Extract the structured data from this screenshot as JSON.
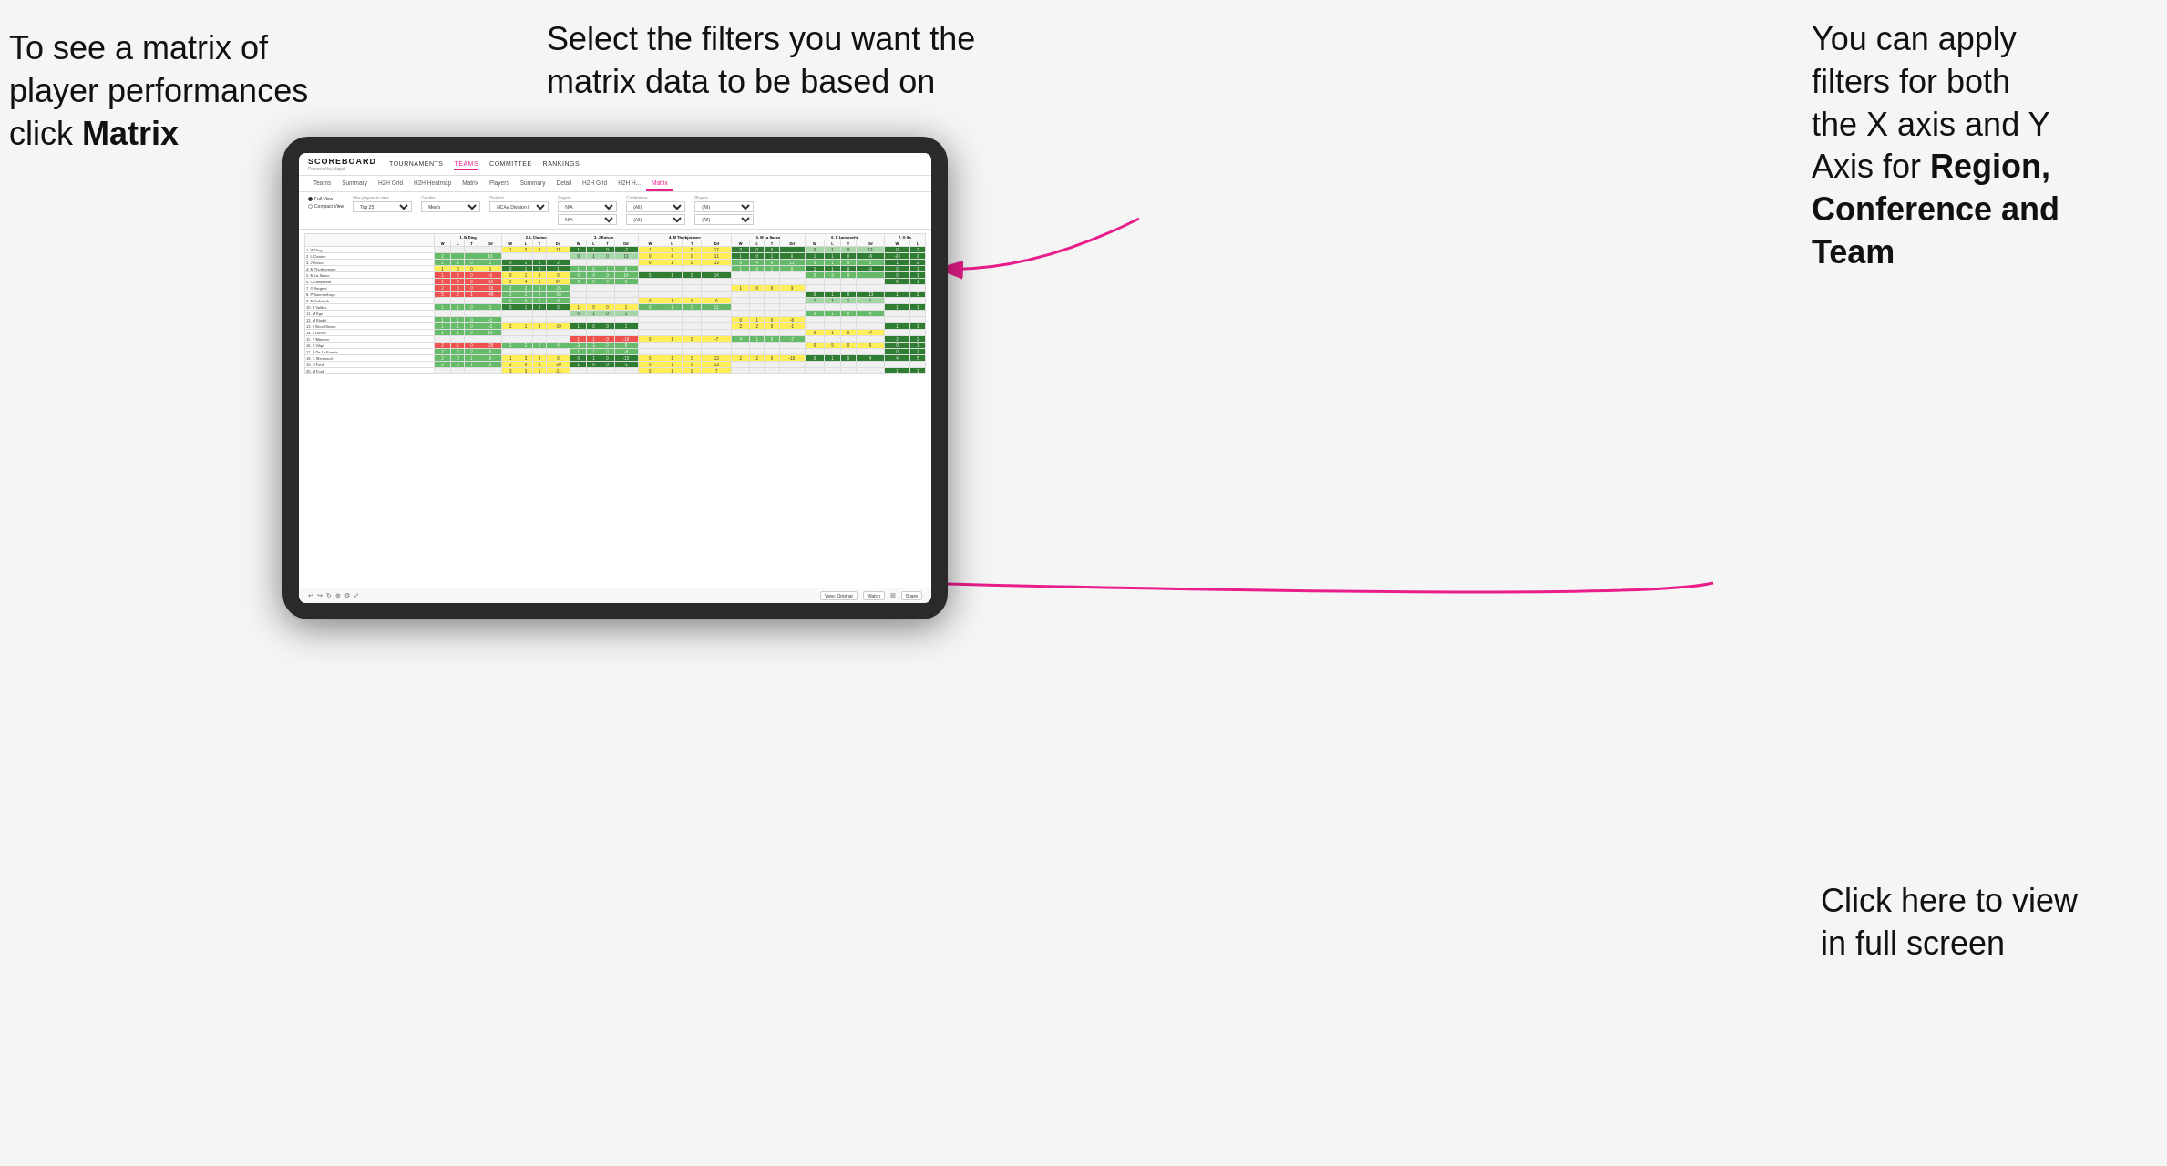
{
  "annotations": {
    "top_left": {
      "line1": "To see a matrix of",
      "line2": "player performances",
      "line3_prefix": "click ",
      "line3_bold": "Matrix"
    },
    "top_center": {
      "text": "Select the filters you want the matrix data to be based on"
    },
    "top_right": {
      "line1": "You  can apply",
      "line2": "filters for both",
      "line3": "the X axis and Y",
      "line4_prefix": "Axis for ",
      "line4_bold": "Region,",
      "line5_bold": "Conference and",
      "line6_bold": "Team"
    },
    "bottom_right": {
      "line1": "Click here to view",
      "line2": "in full screen"
    }
  },
  "app": {
    "logo_title": "SCOREBOARD",
    "logo_sub": "Powered by clippd",
    "nav_items": [
      "TOURNAMENTS",
      "TEAMS",
      "COMMITTEE",
      "RANKINGS"
    ],
    "sub_nav_items": [
      "Teams",
      "Summary",
      "H2H Grid",
      "H2H Heatmap",
      "Matrix",
      "Players",
      "Summary",
      "Detail",
      "H2H Grid",
      "H2H H...",
      "Matrix"
    ],
    "active_nav": "TEAMS",
    "active_sub": "Matrix",
    "filters": {
      "view_full": "Full View",
      "view_compact": "Compact View",
      "max_players_label": "Max players in view",
      "max_players_val": "Top 25",
      "gender_label": "Gender",
      "gender_val": "Men's",
      "division_label": "Division",
      "division_val": "NCAA Division I",
      "region_label": "Region",
      "region_val1": "N/A",
      "region_val2": "N/A",
      "conference_label": "Conference",
      "conf_val1": "(All)",
      "conf_val2": "(All)",
      "players_label": "Players",
      "players_val1": "(All)",
      "players_val2": "(All)"
    },
    "column_headers": [
      "1. W Ding",
      "2. L Clanton",
      "3. J Koivun",
      "4. M Thorbjornsen",
      "5. M La Sasso",
      "6. C Lamprecht",
      "7. G Sa"
    ],
    "col_subheaders": [
      "W",
      "L",
      "T",
      "Dif"
    ],
    "rows": [
      {
        "name": "1. W Ding"
      },
      {
        "name": "2. L Clanton"
      },
      {
        "name": "3. J Koivun"
      },
      {
        "name": "4. M Thorbjornsen"
      },
      {
        "name": "5. M La Sasso"
      },
      {
        "name": "6. C Lamprecht"
      },
      {
        "name": "7. G Sargent"
      },
      {
        "name": "8. P Summerhays"
      },
      {
        "name": "9. N Gabrelcik"
      },
      {
        "name": "10. B Valdes"
      },
      {
        "name": "11. M Ege"
      },
      {
        "name": "12. M Riedel"
      },
      {
        "name": "13. J Skov Olesen"
      },
      {
        "name": "14. J Lundin"
      },
      {
        "name": "15. P Maichon"
      },
      {
        "name": "16. K Vilips"
      },
      {
        "name": "17. S De La Fuente"
      },
      {
        "name": "18. C Sherwood"
      },
      {
        "name": "19. D Ford"
      },
      {
        "name": "20. M Ford"
      }
    ],
    "bottom_bar": {
      "view_original": "View: Original",
      "watch": "Watch",
      "share": "Share"
    }
  },
  "colors": {
    "arrow": "#e91e8c",
    "active_tab": "#e91e8c"
  }
}
